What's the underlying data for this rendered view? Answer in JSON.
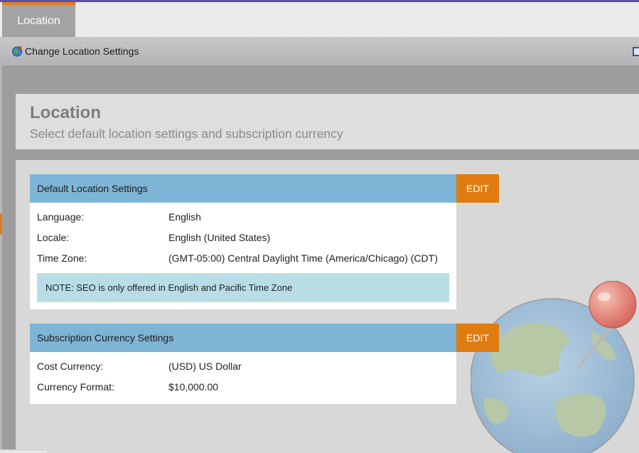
{
  "tabs": [
    {
      "label": "Location"
    }
  ],
  "toolbar": {
    "change_location_label": "Change Location Settings"
  },
  "header": {
    "title": "Location",
    "subtitle": "Select default location settings and subscription currency"
  },
  "default_location": {
    "title": "Default Location Settings",
    "edit_label": "EDIT",
    "rows": [
      {
        "label": "Language:",
        "value": "English"
      },
      {
        "label": "Locale:",
        "value": "English (United States)"
      },
      {
        "label": "Time Zone:",
        "value": "(GMT-05:00) Central Daylight Time (America/Chicago) (CDT)"
      }
    ],
    "note": "NOTE:  SEO is only offered in English and Pacific Time Zone"
  },
  "subscription_currency": {
    "title": "Subscription Currency Settings",
    "edit_label": "EDIT",
    "rows": [
      {
        "label": "Cost Currency:",
        "value": "(USD) US Dollar"
      },
      {
        "label": "Currency Format:",
        "value": "$10,000.00"
      }
    ]
  },
  "colors": {
    "accent_orange": "#e07c10",
    "panel_header_blue": "#7eb5d6",
    "note_background": "#b8dde6"
  },
  "icons": [
    "globe-icon",
    "globe-pin-illustration"
  ]
}
